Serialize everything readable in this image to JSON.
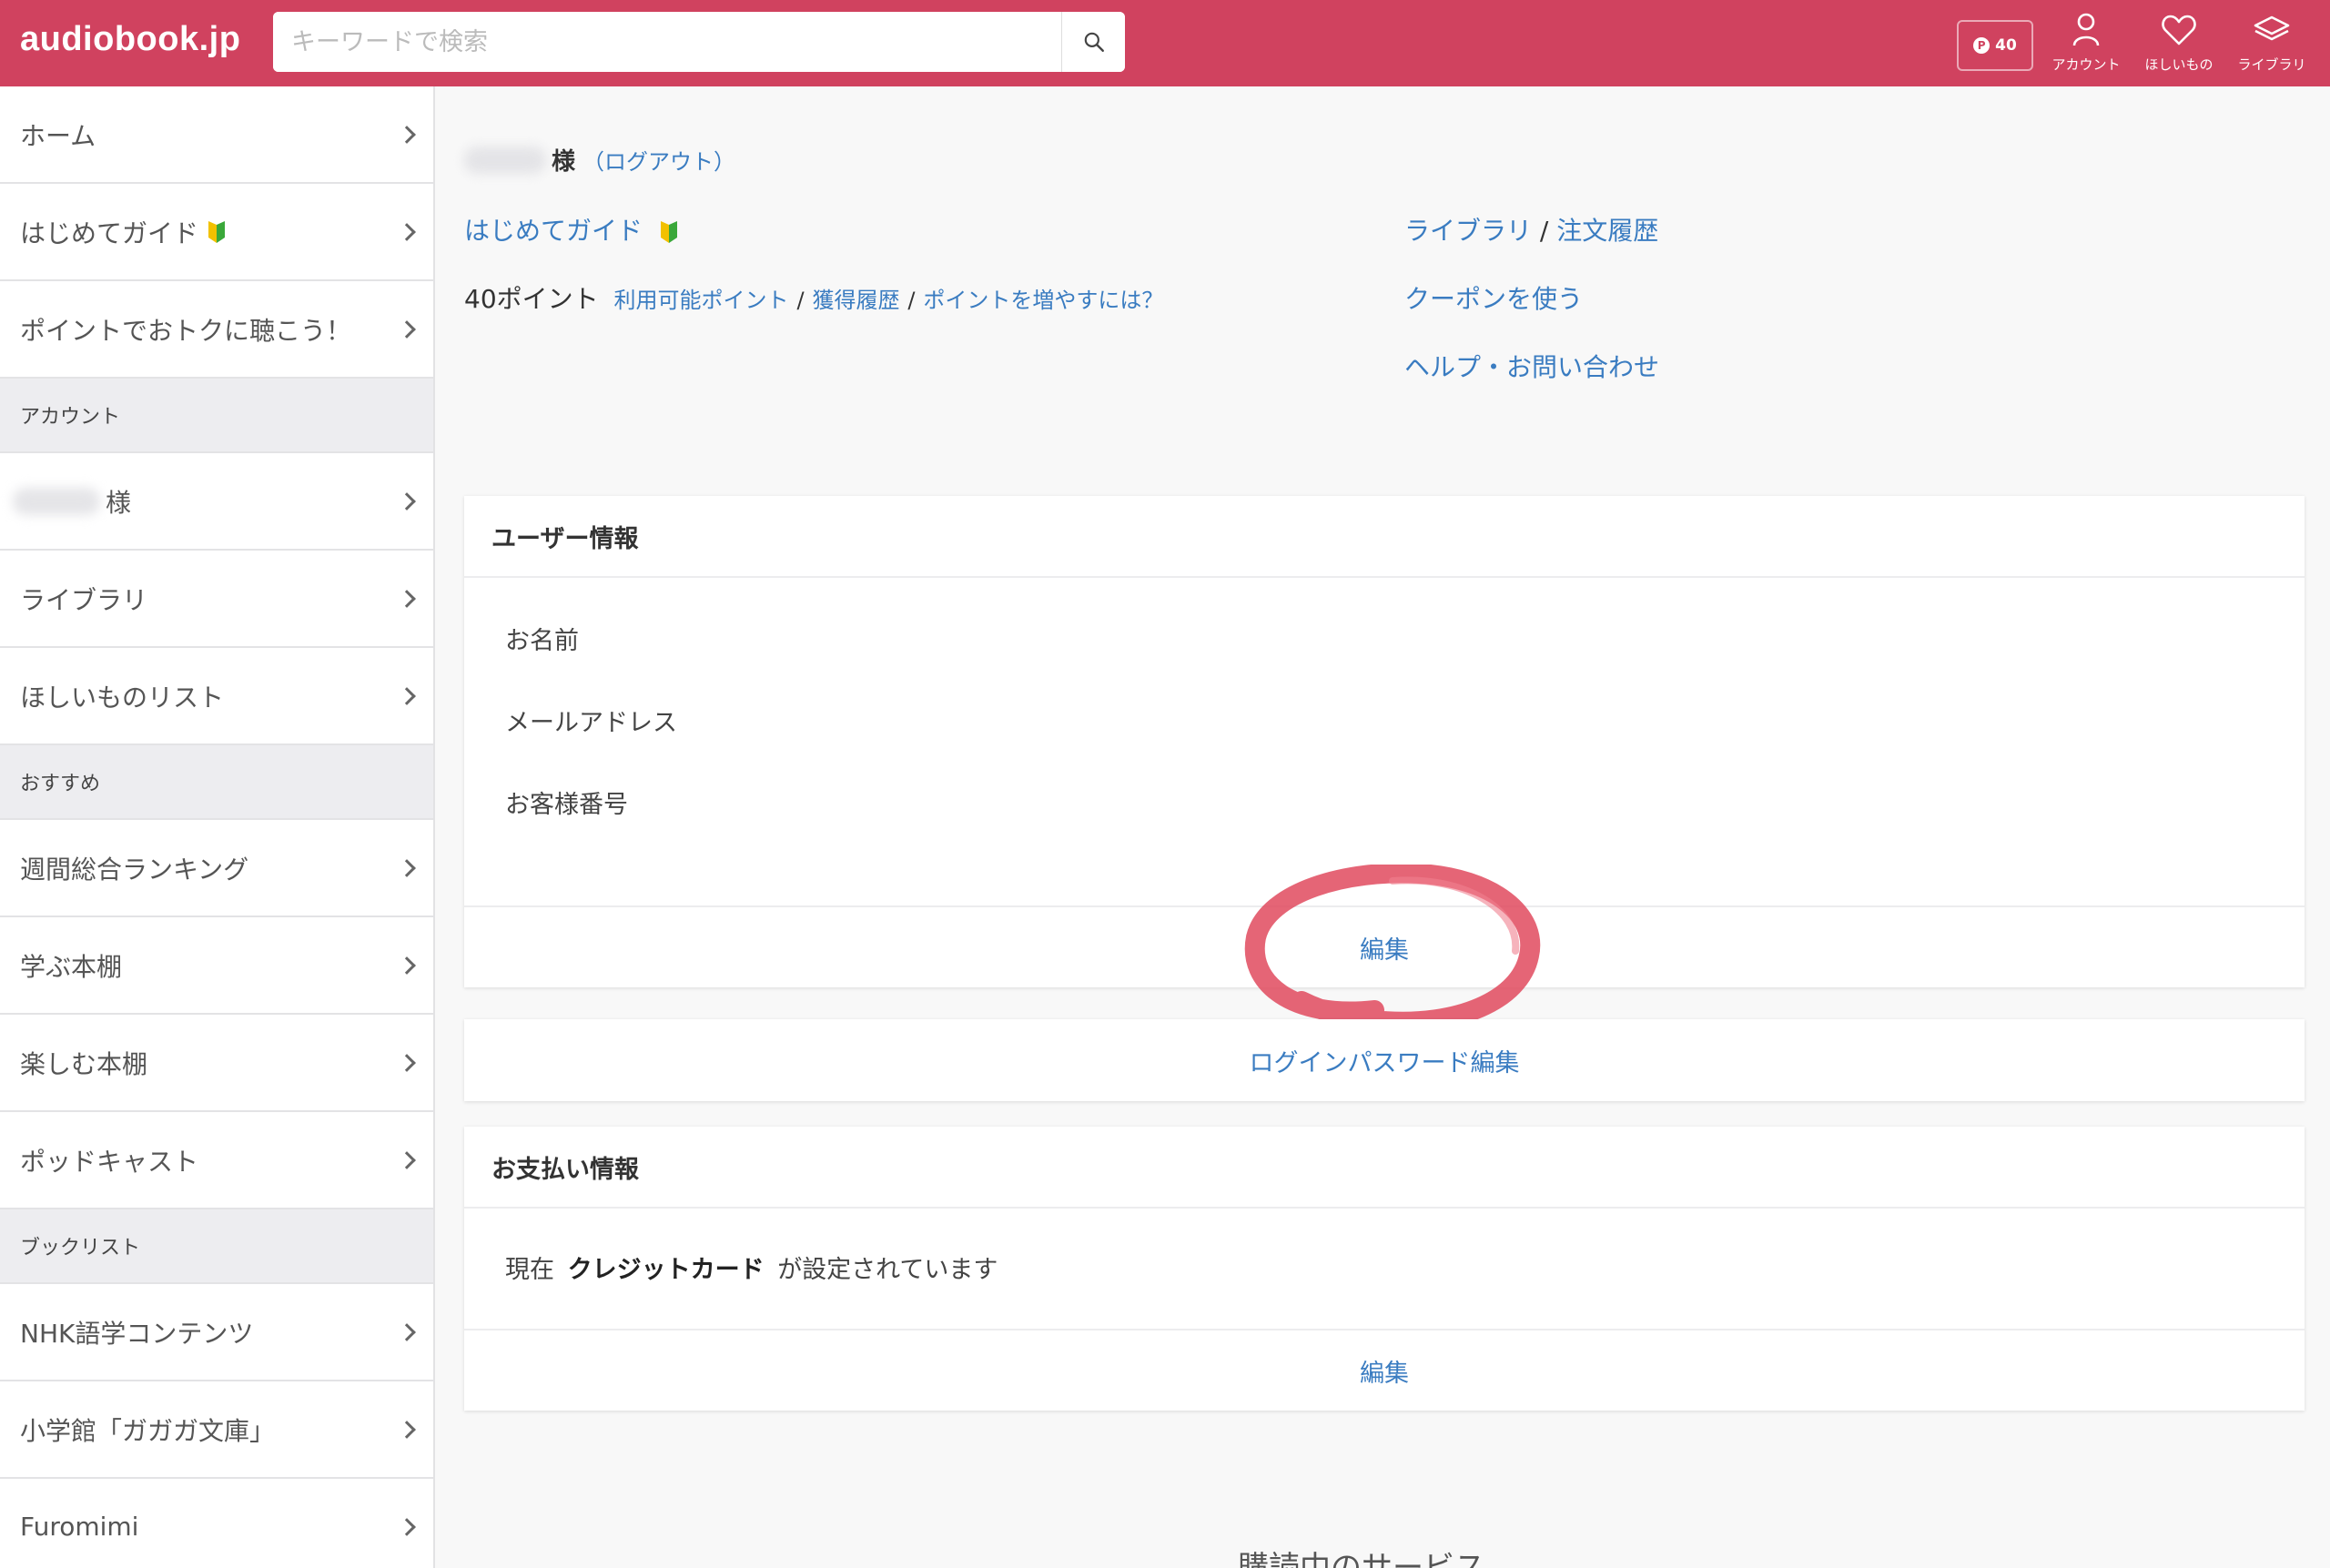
{
  "header": {
    "logo": "audiobook.jp",
    "search_placeholder": "キーワードで検索",
    "points_badge": "40",
    "icons": [
      {
        "name": "account-icon",
        "label": "アカウント"
      },
      {
        "name": "heart-icon",
        "label": "ほしいもの"
      },
      {
        "name": "library-icon",
        "label": "ライブラリ"
      }
    ],
    "accent_color": "#d0425f"
  },
  "sidebar": {
    "items": [
      {
        "label": "ホーム",
        "type": "link"
      },
      {
        "label": "はじめてガイド",
        "type": "link",
        "beginner_mark": true
      },
      {
        "label": "ポイントでおトクに聴こう！",
        "type": "link"
      },
      {
        "label": "アカウント",
        "type": "heading"
      },
      {
        "label": "様",
        "type": "link",
        "blurred_name": true
      },
      {
        "label": "ライブラリ",
        "type": "link"
      },
      {
        "label": "ほしいものリスト",
        "type": "link"
      },
      {
        "label": "おすすめ",
        "type": "heading"
      },
      {
        "label": "週間総合ランキング",
        "type": "link"
      },
      {
        "label": "学ぶ本棚",
        "type": "link"
      },
      {
        "label": "楽しむ本棚",
        "type": "link"
      },
      {
        "label": "ポッドキャスト",
        "type": "link"
      },
      {
        "label": "ブックリスト",
        "type": "heading"
      },
      {
        "label": "NHK語学コンテンツ",
        "type": "link"
      },
      {
        "label": "小学館「ガガガ文庫」",
        "type": "link"
      },
      {
        "label": "Furomimi",
        "type": "link"
      }
    ]
  },
  "main": {
    "greeting_suffix": "様",
    "logout_open": "（",
    "logout_label": "ログアウト",
    "logout_close": "）",
    "guide_link": "はじめてガイド",
    "points_text": "40ポイント",
    "points_links": [
      "利用可能ポイント",
      "獲得履歴",
      "ポイントを増やすには？"
    ],
    "separator": "/",
    "library_link": "ライブラリ",
    "order_history_link": "注文履歴",
    "coupon_link": "クーポンを使う",
    "help_link": "ヘルプ・お問い合わせ",
    "user_info": {
      "title": "ユーザー情報",
      "fields": [
        "お名前",
        "メールアドレス",
        "お客様番号"
      ],
      "edit_label": "編集"
    },
    "password_edit_label": "ログインパスワード編集",
    "payment_info": {
      "title": "お支払い情報",
      "status_prefix": "現在",
      "status_method": "クレジットカード",
      "status_suffix": "が設定されています",
      "edit_label": "編集"
    },
    "cutoff_heading": "購読中のサービス"
  }
}
